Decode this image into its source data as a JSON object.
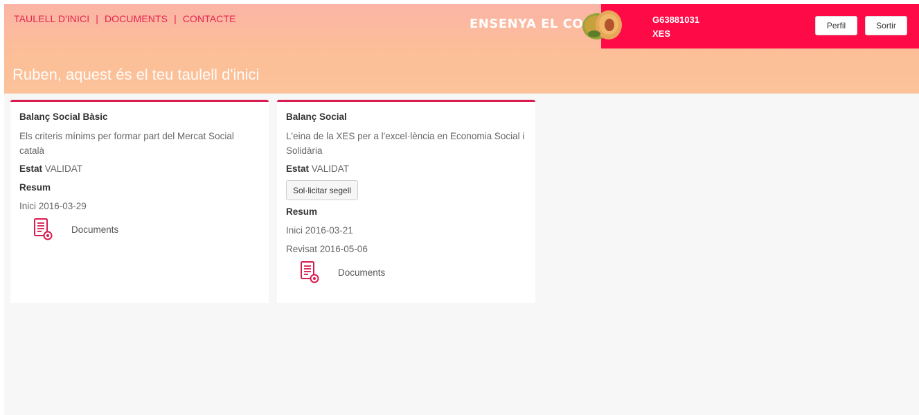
{
  "nav": {
    "items": [
      "TAULELL D'INICI",
      "DOCUMENTS",
      "CONTACTE"
    ],
    "separator": "|"
  },
  "brand": {
    "text": "ENSENYA EL COR",
    "logo_icon": "heart-fruit-logo"
  },
  "user": {
    "id": "G63881031",
    "org": "XES"
  },
  "buttons": {
    "profile": "Perfil",
    "logout": "Sortir"
  },
  "welcome": "Ruben, aquest és el teu taulell d'inici",
  "cards": [
    {
      "title": "Balanç Social Bàsic",
      "description": "Els criteris mínims per formar part del Mercat Social català",
      "status_label": "Estat",
      "status_value": "VALIDAT",
      "summary_label": "Resum",
      "start": "Inici 2016-03-29",
      "documents_label": "Documents"
    },
    {
      "title": "Balanç Social",
      "description": "L'eina de la XES per a l'excel·lència en Economia Social i Solidària",
      "status_label": "Estat",
      "status_value": "VALIDAT",
      "seal_button": "Sol·licitar segell",
      "summary_label": "Resum",
      "start": "Inici 2016-03-21",
      "reviewed": "Revisat 2016-05-06",
      "documents_label": "Documents"
    }
  ],
  "colors": {
    "accent": "#e8214e",
    "red_panel": "#fe0a47",
    "card_border": "#d81b50",
    "header_top": "#fbb4a6",
    "header_bottom": "#fcc29a"
  }
}
